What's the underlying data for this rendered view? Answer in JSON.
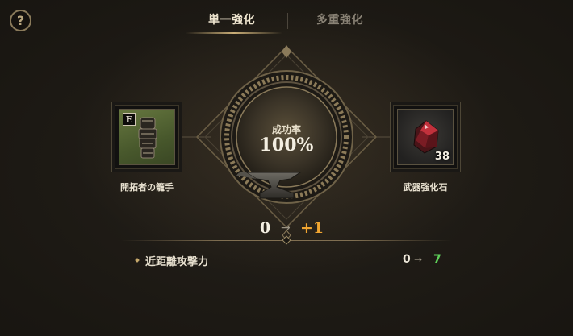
{
  "help": {
    "icon": "help-icon",
    "symbol": "?"
  },
  "tabs": [
    {
      "label": "単一強化",
      "active": true
    },
    {
      "label": "多重強化",
      "active": false
    }
  ],
  "success": {
    "label": "成功率",
    "value": "100%"
  },
  "equipment": {
    "name": "開拓者の籠手",
    "grade": "E",
    "icon": "gauntlet-icon"
  },
  "material": {
    "name": "武器強化石",
    "count": "38",
    "icon": "enhancement-stone-icon"
  },
  "enhance": {
    "from": "0",
    "arrow": "→",
    "to": "+1",
    "icon": "anvil-icon"
  },
  "stats": [
    {
      "label": "近距離攻撃力",
      "from": "0",
      "arrow": "→",
      "to": "7"
    }
  ],
  "colors": {
    "accent": "#f0a531",
    "increase": "#5fd15a",
    "frame": "#8a7a5a"
  }
}
